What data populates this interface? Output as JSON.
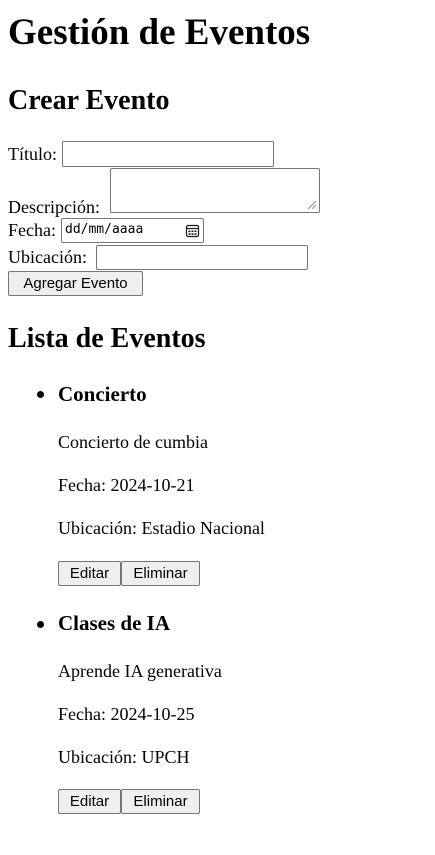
{
  "page": {
    "title": "Gestión de Eventos"
  },
  "form": {
    "heading": "Crear Evento",
    "titulo_label": "Título:",
    "titulo_value": "",
    "descripcion_label": "Descripción:",
    "descripcion_value": "",
    "fecha_label": "Fecha:",
    "fecha_placeholder": "dd/mm/aaaa",
    "fecha_icon": "calendar-icon",
    "ubicacion_label": "Ubicación:",
    "ubicacion_value": "",
    "submit_label": "Agregar Evento"
  },
  "list": {
    "heading": "Lista de Eventos",
    "events": [
      {
        "title": "Concierto",
        "description": "Concierto de cumbia",
        "date_text": "Fecha: 2024-10-21",
        "location_text": "Ubicación: Estadio Nacional",
        "edit_label": "Editar",
        "delete_label": "Eliminar"
      },
      {
        "title": "Clases de IA",
        "description": "Aprende IA generativa",
        "date_text": "Fecha: 2024-10-25",
        "location_text": "Ubicación: UPCH",
        "edit_label": "Editar",
        "delete_label": "Eliminar"
      }
    ]
  }
}
